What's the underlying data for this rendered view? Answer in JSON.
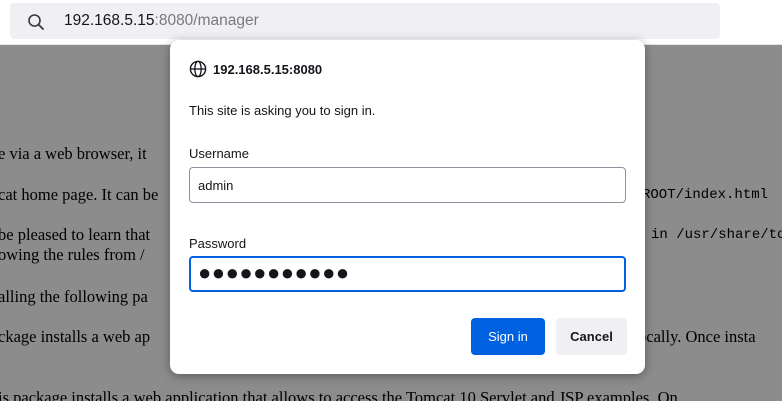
{
  "address_bar": {
    "url_host": "192.168.5.15",
    "url_rest": ":8080/manager",
    "icon": "search-icon"
  },
  "page": {
    "lines": [
      {
        "text": "e via a web browser, it"
      },
      {
        "text": "cat home page. It can be"
      },
      {
        "text": "ROOT/index.html",
        "mono": true
      },
      {
        "text": "be pleased to learn that"
      },
      {
        "text": "in /usr/share/tom"
      },
      {
        "text": "owing the rules from /"
      },
      {
        "text": "alling the following pa"
      },
      {
        "text": "ckage installs a web ap"
      },
      {
        "text": "ocally. Once insta"
      },
      {
        "text": "is package installs a web application that allows to access the Tomcat 10 Servlet and JSP examples. On"
      }
    ]
  },
  "dialog": {
    "origin": "192.168.5.15:8080",
    "origin_icon": "globe-icon",
    "message": "This site is asking you to sign in.",
    "username_label": "Username",
    "username_value": "admin",
    "password_label": "Password",
    "password_value": "●●●●●●●●●●●",
    "sign_in_label": "Sign in",
    "cancel_label": "Cancel",
    "accent_color": "#0061e0"
  }
}
